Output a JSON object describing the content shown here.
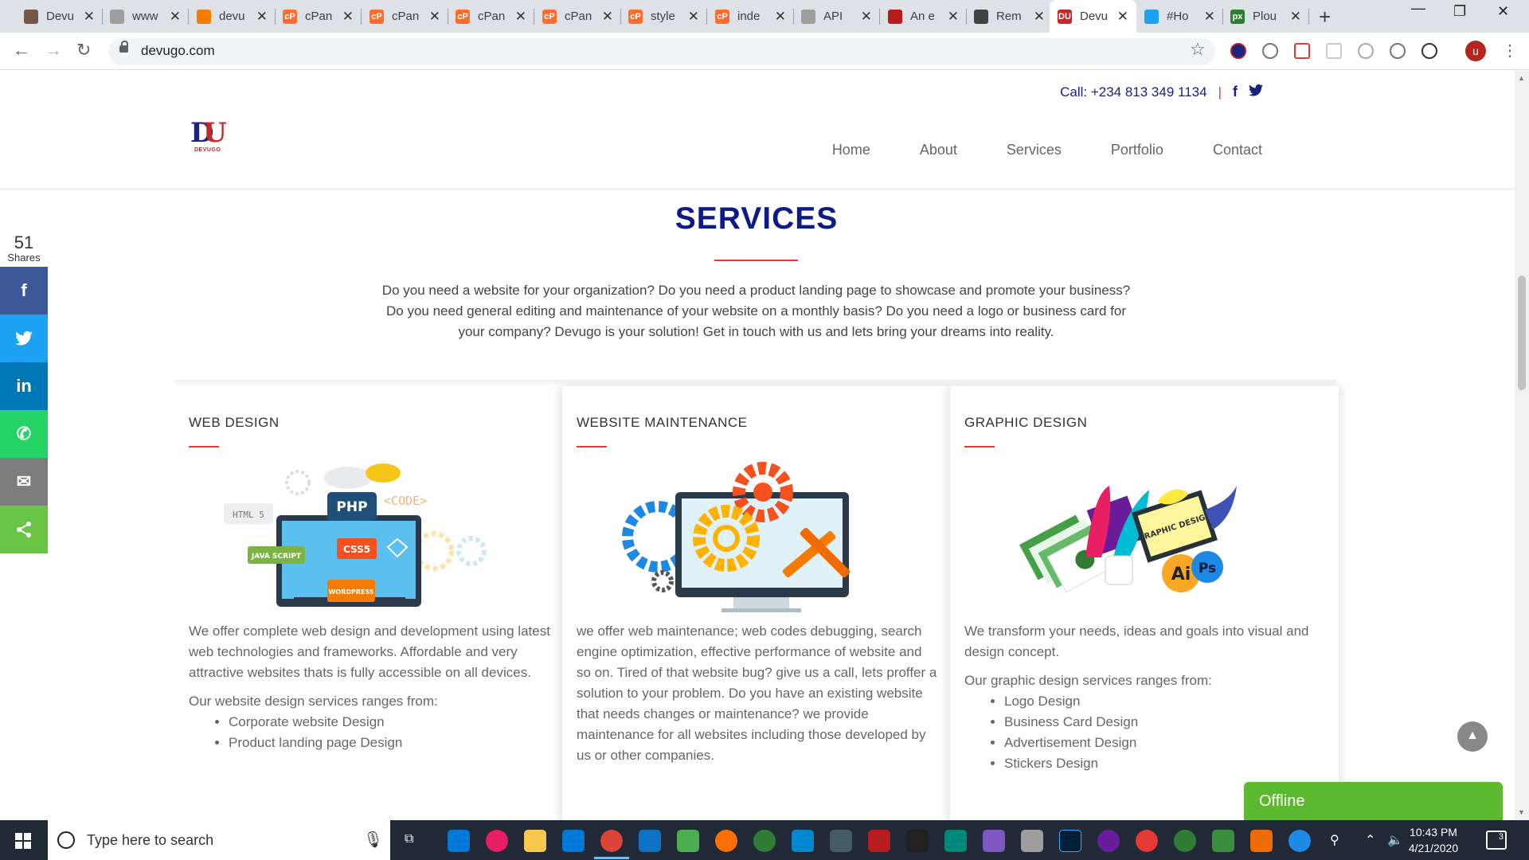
{
  "browser": {
    "tabs": [
      {
        "title": "Devu",
        "color": "#795548",
        "glyph": "",
        "active": false
      },
      {
        "title": "www",
        "color": "#9e9e9e",
        "glyph": "",
        "active": false
      },
      {
        "title": "devu",
        "color": "#f57c00",
        "glyph": "",
        "active": false
      },
      {
        "title": "cPan",
        "color": "#ff6c2c",
        "glyph": "cP",
        "active": false
      },
      {
        "title": "cPan",
        "color": "#ff6c2c",
        "glyph": "cP",
        "active": false
      },
      {
        "title": "cPan",
        "color": "#ff6c2c",
        "glyph": "cP",
        "active": false
      },
      {
        "title": "cPan",
        "color": "#ff6c2c",
        "glyph": "cP",
        "active": false
      },
      {
        "title": "style",
        "color": "#ff6c2c",
        "glyph": "cP",
        "active": false
      },
      {
        "title": "inde",
        "color": "#ff6c2c",
        "glyph": "cP",
        "active": false
      },
      {
        "title": "API",
        "color": "#9e9e9e",
        "glyph": "",
        "active": false
      },
      {
        "title": "An e",
        "color": "#b71c1c",
        "glyph": "",
        "active": false
      },
      {
        "title": "Rem",
        "color": "#424242",
        "glyph": "",
        "active": false
      },
      {
        "title": "Devu",
        "color": "#c62828",
        "glyph": "DU",
        "active": true
      },
      {
        "title": "#Ho",
        "color": "#1da1f2",
        "glyph": "",
        "active": false
      },
      {
        "title": "Plou",
        "color": "#2e7d32",
        "glyph": "px",
        "active": false
      }
    ],
    "url": "devugo.com",
    "profile_initial": "u"
  },
  "site": {
    "call": "Call: +234 813 349 1134",
    "logo_text": "DEVUGO",
    "nav": [
      "Home",
      "About",
      "Services",
      "Portfolio",
      "Contact"
    ],
    "title": "SERVICES",
    "intro": "Do you need a website for your organization? Do you need a product landing page to showcase and promote your business? Do you need general editing and maintenance of your website on a monthly basis? Do you need a logo or business card for your company? Devugo is your solution! Get in touch with us and lets bring your dreams into reality.",
    "cards": [
      {
        "title": "WEB DESIGN",
        "desc": "We offer complete web design and development using latest web technologies and frameworks. Affordable and very attractive websites thats is fully accessible on all devices.",
        "list_intro": "Our website design services ranges from:",
        "items": [
          "Corporate website Design",
          "Product landing page Design"
        ]
      },
      {
        "title": "WEBSITE MAINTENANCE",
        "desc": "we offer web maintenance; web codes debugging, search engine optimization, effective performance of website and so on. Tired of that website bug? give us a call, lets proffer a solution to your problem. Do you have an existing website that needs changes or maintenance? we provide maintenance for all websites including those developed by us or other companies."
      },
      {
        "title": "GRAPHIC DESIGN",
        "desc": "We transform your needs, ideas and goals into visual and design concept.",
        "list_intro": "Our graphic design services ranges from:",
        "items": [
          "Logo Design",
          "Business Card Design",
          "Advertisement Design",
          "Stickers Design"
        ]
      }
    ],
    "illustration_labels": {
      "html5": "HTML 5",
      "php": "PHP",
      "code": "<CODE>",
      "js": "JAVA SCRIPT",
      "css": "CSS5",
      "wordpress": "WORDPRESS",
      "graphic": "GRAPHIC DESIGN",
      "ai": "Ai",
      "ps": "Ps"
    },
    "share": {
      "count": "51",
      "label": "Shares",
      "buttons": [
        {
          "name": "facebook",
          "glyph": "f",
          "color": "#3b5998"
        },
        {
          "name": "twitter",
          "glyph": "🐦",
          "color": "#1da1f2"
        },
        {
          "name": "linkedin",
          "glyph": "in",
          "color": "#0077b5"
        },
        {
          "name": "whatsapp",
          "glyph": "✆",
          "color": "#25d366"
        },
        {
          "name": "email",
          "glyph": "✉",
          "color": "#7d7d7d"
        },
        {
          "name": "share",
          "glyph": "<",
          "color": "#6ac445"
        }
      ]
    },
    "chat_status": "Offline"
  },
  "taskbar": {
    "search_placeholder": "Type here to search",
    "time": "10:43 PM",
    "date": "4/21/2020",
    "notifications": "3"
  }
}
